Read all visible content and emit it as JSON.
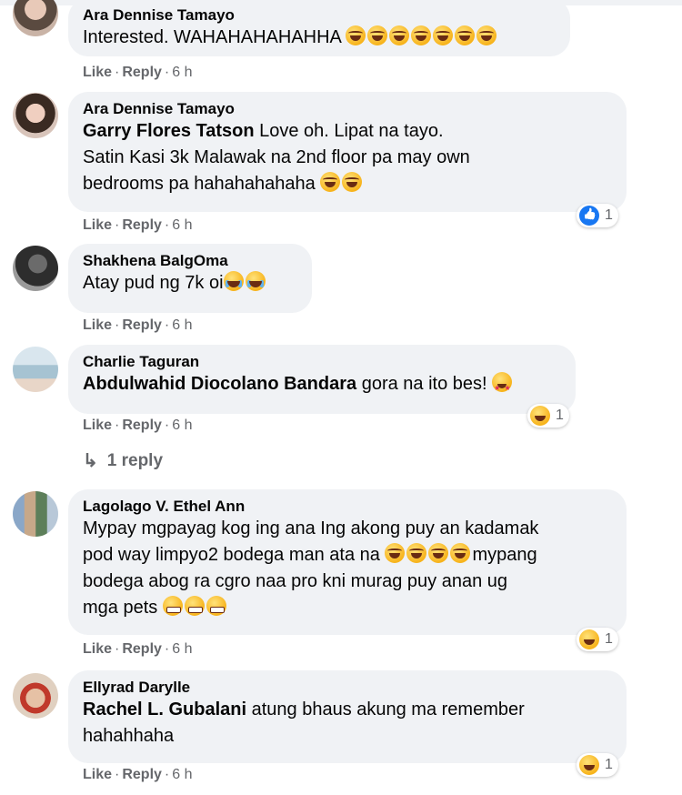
{
  "comments": [
    {
      "author": "Ara Dennise Tamayo",
      "text": "Interested. WAHAHAHAHAHHA",
      "emojis": [
        "rofl",
        "rofl",
        "rofl",
        "rofl",
        "rofl",
        "rofl",
        "rofl"
      ],
      "like": "Like",
      "reply": "Reply",
      "time": "6 h"
    },
    {
      "author": "Ara Dennise Tamayo",
      "tag": "Garry Flores Tatson",
      "text_line1": " Love oh. Lipat na tayo.",
      "text_line2": "Satin Kasi 3k Malawak na 2nd floor pa may own",
      "text_line3": "bedrooms pa hahahahahaha",
      "emojis": [
        "rofl",
        "rofl"
      ],
      "like": "Like",
      "reply": "Reply",
      "time": "6 h",
      "reaction": {
        "type": "like",
        "count": "1"
      }
    },
    {
      "author": "Shakhena BalgOma",
      "text": "Atay pud ng 7k oi",
      "emojis": [
        "joy",
        "joy"
      ],
      "like": "Like",
      "reply": "Reply",
      "time": "6 h"
    },
    {
      "author": "Charlie Taguran",
      "tag": "Abdulwahid Diocolano Bandara",
      "text": " gora na ito bes! ",
      "emojis": [
        "star-struck"
      ],
      "like": "Like",
      "reply": "Reply",
      "time": "6 h",
      "reaction": {
        "type": "haha",
        "count": "1"
      }
    },
    {
      "author": "Lagolago V. Ethel Ann",
      "text_line1": "Mypay mgpayag kog ing ana Ing akong puy an kadamak",
      "text_line2a": "pod way limpyo2 bodega man ata na ",
      "text_line2b": "mypang",
      "text_line3": "bodega abog ra cgro naa pro kni murag puy anan ug",
      "text_line4": "mga pets ",
      "emojis_a": [
        "rofl",
        "rofl",
        "rofl",
        "rofl"
      ],
      "emojis_b": [
        "grin",
        "grin",
        "grin"
      ],
      "like": "Like",
      "reply": "Reply",
      "time": "6 h",
      "reaction": {
        "type": "haha",
        "count": "1"
      }
    },
    {
      "author": "Ellyrad Darylle",
      "tag": "Rachel L. Gubalani",
      "text_line1": " atung bhaus akung ma remember",
      "text_line2": "hahahhaha",
      "like": "Like",
      "reply": "Reply",
      "time": "6 h",
      "reaction": {
        "type": "haha",
        "count": "1"
      }
    }
  ],
  "replies_link": "1 reply",
  "colors": {
    "bubble": "#f0f2f5",
    "meta": "#65676b",
    "like_blue": "#1877f2"
  }
}
